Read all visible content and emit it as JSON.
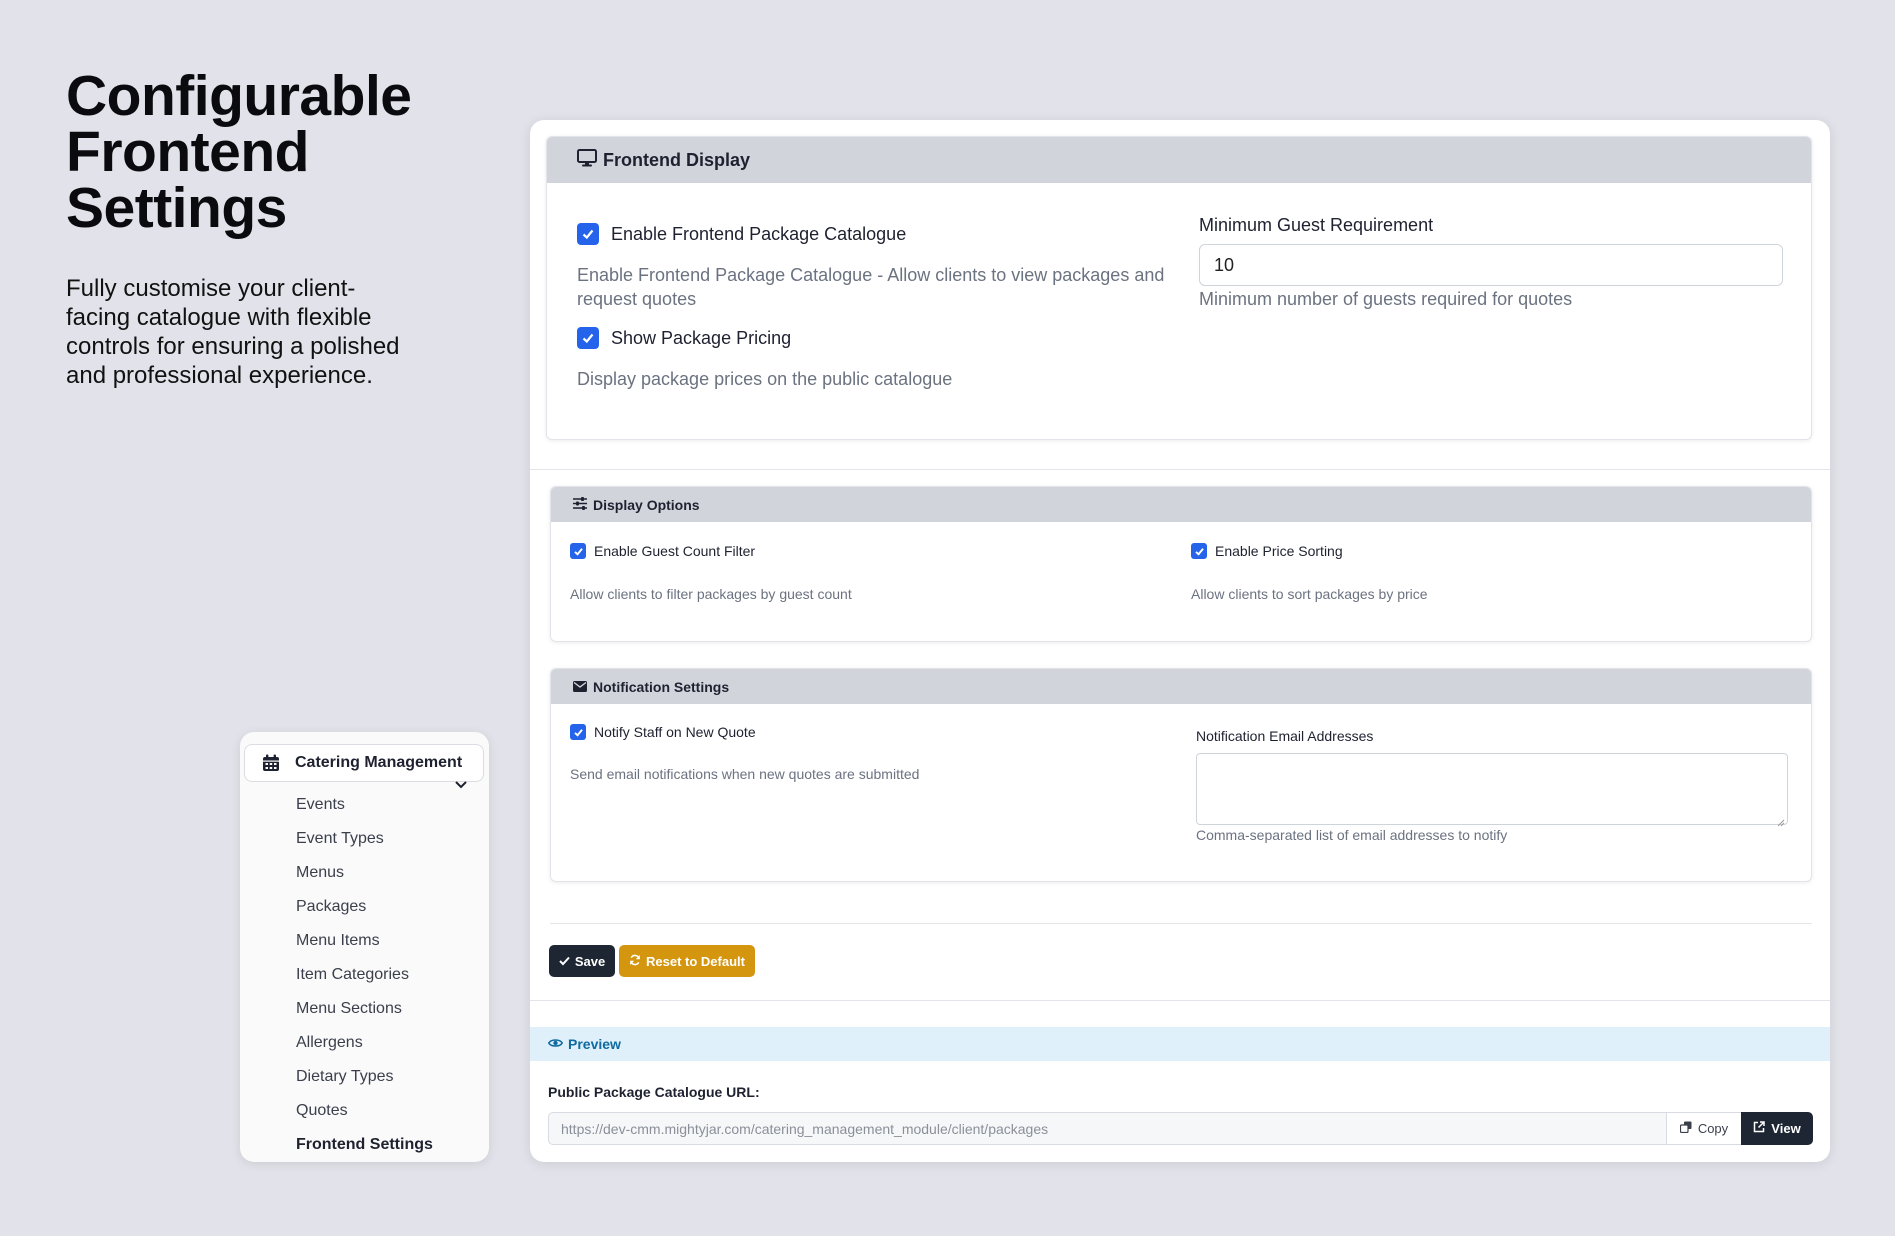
{
  "hero": {
    "title_lines": [
      "Configurable",
      "Frontend",
      "Settings"
    ],
    "subtitle": "Fully customise your client-facing catalogue with flexible controls for ensuring a polished and professional experience."
  },
  "sidebar": {
    "header": "Catering Management",
    "items": [
      "Events",
      "Event Types",
      "Menus",
      "Packages",
      "Menu Items",
      "Item Categories",
      "Menu Sections",
      "Allergens",
      "Dietary Types",
      "Quotes",
      "Frontend Settings"
    ],
    "active_item": "Frontend Settings"
  },
  "frontend_display": {
    "title": "Frontend Display",
    "enable_catalogue": {
      "label": "Enable Frontend Package Catalogue",
      "checked": true,
      "help": "Enable Frontend Package Catalogue - Allow clients to view packages and request quotes"
    },
    "show_pricing": {
      "label": "Show Package Pricing",
      "checked": true,
      "help": "Display package prices on the public catalogue"
    },
    "min_guests": {
      "label": "Minimum Guest Requirement",
      "value": "10",
      "help": "Minimum number of guests required for quotes"
    }
  },
  "display_options": {
    "title": "Display Options",
    "guest_filter": {
      "label": "Enable Guest Count Filter",
      "checked": true,
      "help": "Allow clients to filter packages by guest count"
    },
    "price_sorting": {
      "label": "Enable Price Sorting",
      "checked": true,
      "help": "Allow clients to sort packages by price"
    }
  },
  "notification_settings": {
    "title": "Notification Settings",
    "notify_staff": {
      "label": "Notify Staff on New Quote",
      "checked": true,
      "help": "Send email notifications when new quotes are submitted"
    },
    "emails": {
      "label": "Notification Email Addresses",
      "value": "",
      "help": "Comma-separated list of email addresses to notify"
    }
  },
  "actions": {
    "save": "Save",
    "reset": "Reset to Default"
  },
  "preview": {
    "title": "Preview",
    "url_label": "Public Package Catalogue URL:",
    "url": "https://dev-cmm.mightyjar.com/catering_management_module/client/packages",
    "copy": "Copy",
    "view": "View"
  },
  "colors": {
    "accent": "#2563eb",
    "dark": "#1e2533",
    "warning": "#d4950f",
    "info_bg": "#dff0fa",
    "info_text": "#0f6aa1"
  },
  "icons": [
    "calendar-icon",
    "chevron-down-icon",
    "monitor-icon",
    "sliders-icon",
    "envelope-icon",
    "check-icon",
    "refresh-icon",
    "eye-icon",
    "copy-icon",
    "external-link-icon"
  ]
}
